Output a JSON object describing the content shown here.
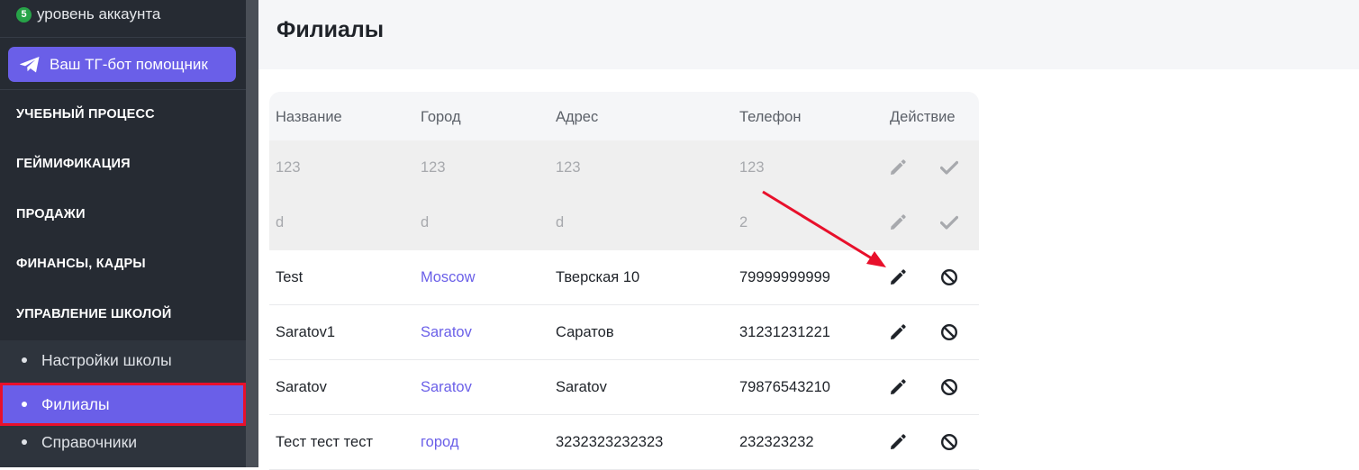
{
  "sidebar": {
    "account_level_number": "5",
    "account_level_text": "уровень аккаунта",
    "tg_button_label": "Ваш ТГ-бот помощник",
    "sections": [
      {
        "label": "УЧЕБНЫЙ ПРОЦЕСС"
      },
      {
        "label": "ГЕЙМИФИКАЦИЯ"
      },
      {
        "label": "ПРОДАЖИ"
      },
      {
        "label": "ФИНАНСЫ, КАДРЫ"
      },
      {
        "label": "УПРАВЛЕНИЕ ШКОЛОЙ"
      }
    ],
    "submenu": [
      {
        "label": "Настройки школы"
      },
      {
        "label": "Филиалы",
        "active": true
      },
      {
        "label": "Справочники"
      }
    ]
  },
  "page": {
    "title": "Филиалы"
  },
  "table": {
    "headers": {
      "name": "Название",
      "city": "Город",
      "address": "Адрес",
      "phone": "Телефон",
      "action": "Действие"
    },
    "rows": [
      {
        "name": "123",
        "city": "123",
        "address": "123",
        "phone": "123",
        "state": "disabled"
      },
      {
        "name": "d",
        "city": "d",
        "address": "d",
        "phone": "2",
        "state": "disabled"
      },
      {
        "name": "Test",
        "city": "Moscow",
        "address": "Тверская 10",
        "phone": "79999999999",
        "state": "active"
      },
      {
        "name": "Saratov1",
        "city": "Saratov",
        "address": "Саратов",
        "phone": "31231231221",
        "state": "active"
      },
      {
        "name": "Saratov",
        "city": "Saratov",
        "address": "Saratov",
        "phone": "79876543210",
        "state": "active"
      },
      {
        "name": "Тест тест тест",
        "city": "город",
        "address": "3232323232323",
        "phone": "232323232",
        "state": "active"
      }
    ]
  },
  "icons": {
    "edit": "pencil-icon",
    "restore": "check-icon",
    "disable": "block-icon",
    "telegram": "telegram-icon"
  },
  "colors": {
    "accent": "#6a5fe8",
    "sidebar_bg": "#262b33",
    "annotation": "#e8102b",
    "level_badge": "#27a348"
  }
}
